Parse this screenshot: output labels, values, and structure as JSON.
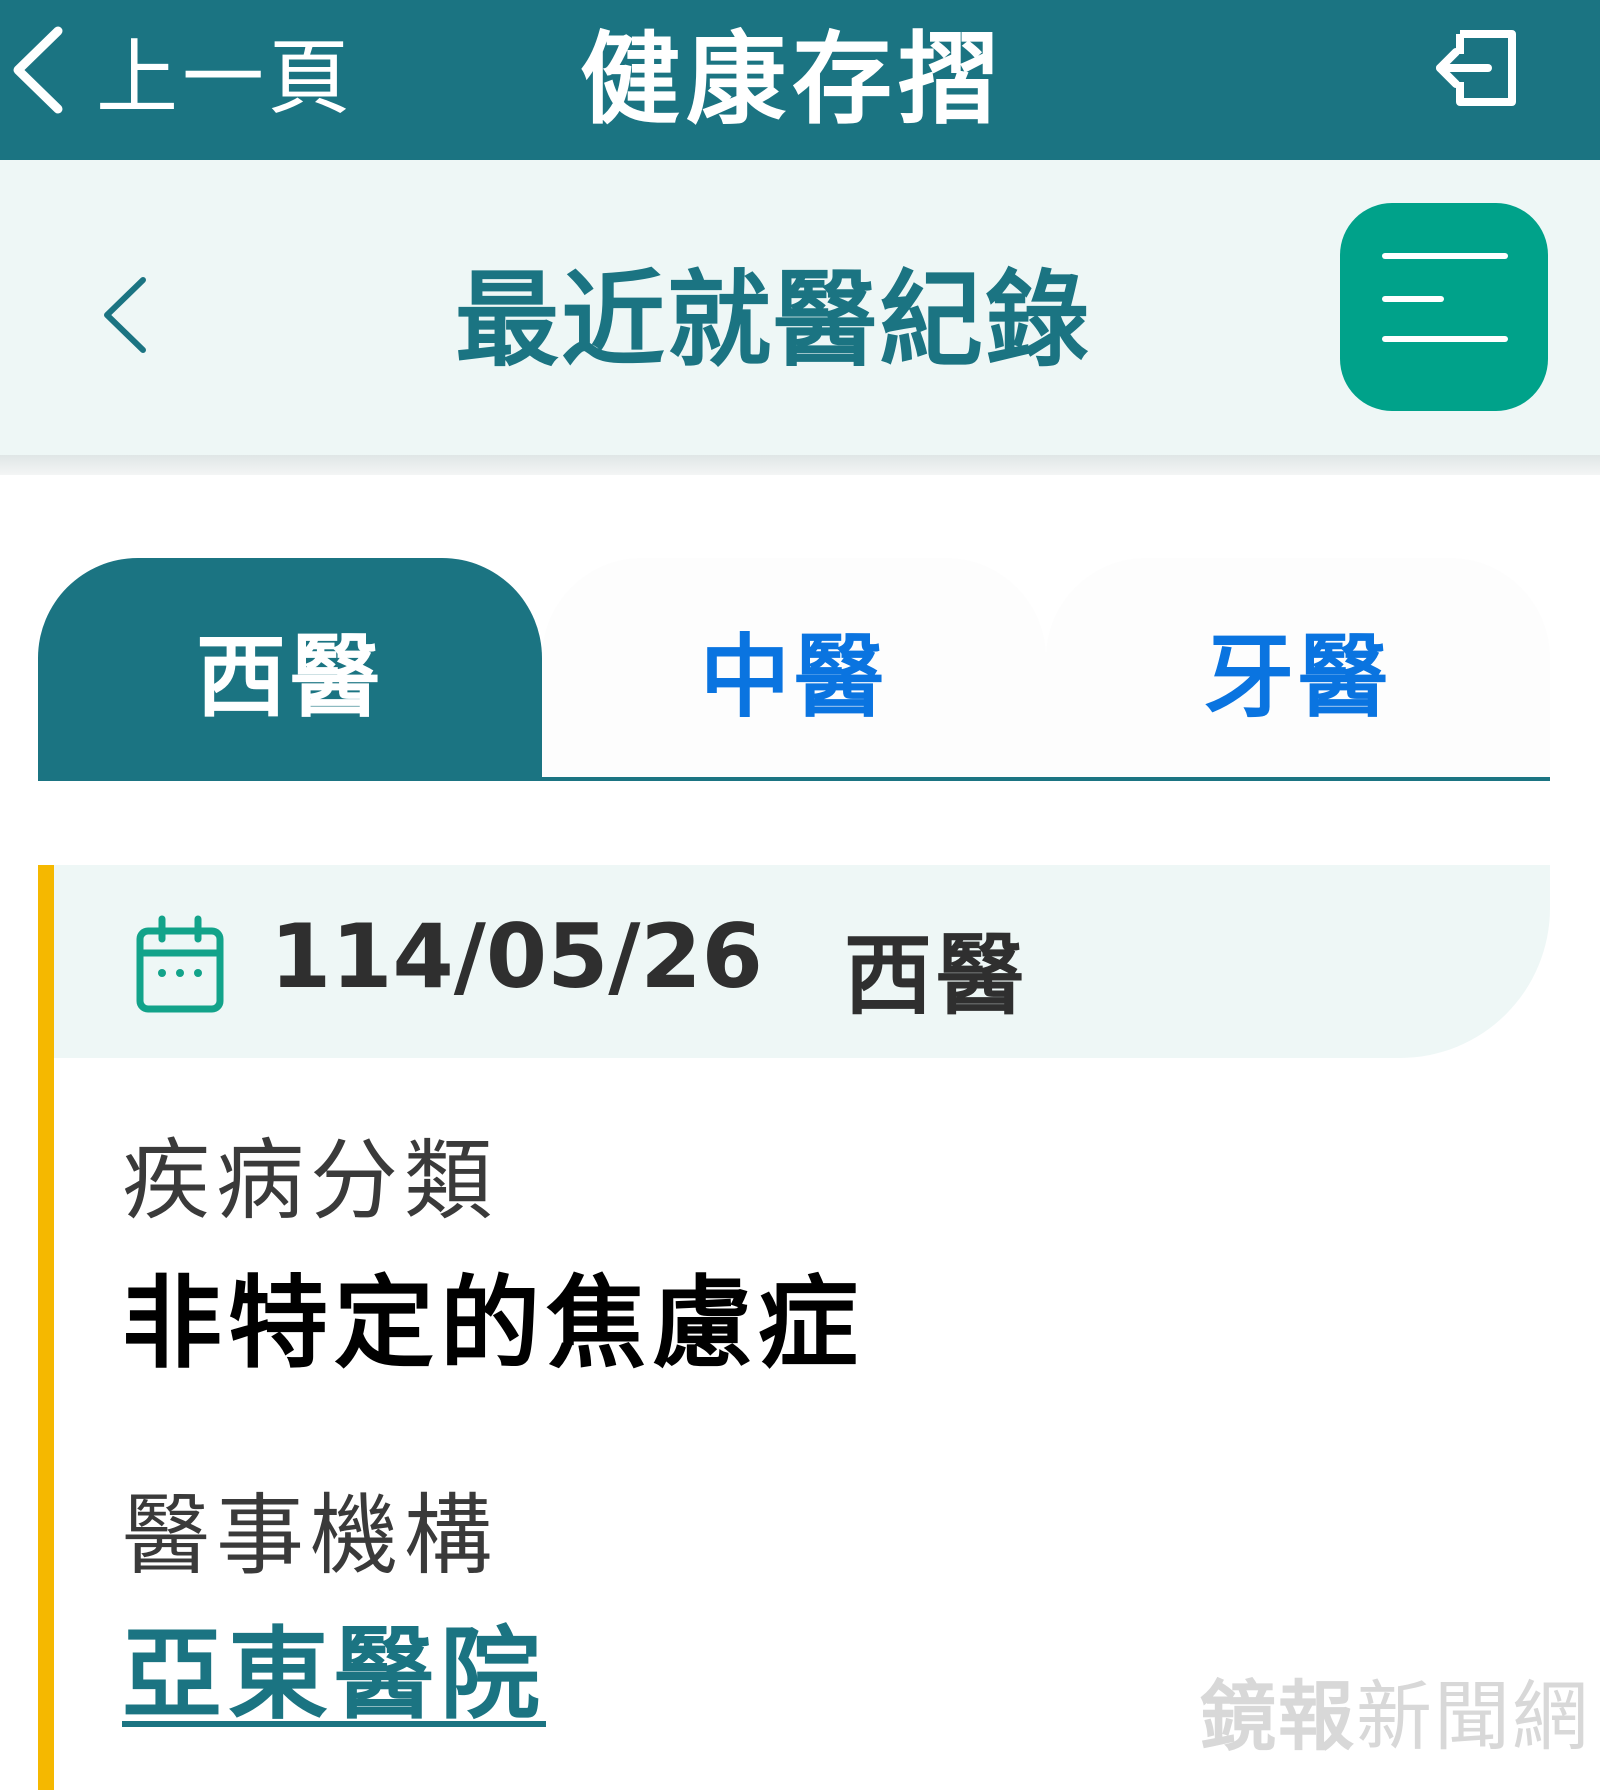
{
  "app_bar": {
    "back_label": "上一頁",
    "title": "健康存摺"
  },
  "sub_header": {
    "title": "最近就醫紀錄"
  },
  "tabs": [
    {
      "label": "西醫",
      "active": true
    },
    {
      "label": "中醫",
      "active": false
    },
    {
      "label": "牙醫",
      "active": false
    }
  ],
  "record": {
    "date": "114/05/26",
    "type": "西醫",
    "disease_label": "疾病分類",
    "disease_value": "非特定的焦慮症",
    "institution_label": "醫事機構",
    "institution_value": "亞東醫院"
  },
  "watermark": {
    "bold": "鏡報",
    "light": "新聞網"
  },
  "colors": {
    "primary": "#1b7482",
    "menu_button": "#00a28a",
    "tab_inactive_text": "#0a74e0",
    "accent_bar": "#f5b800",
    "light_bg": "#eef7f6"
  },
  "icons": {
    "back": "chevron-left-icon",
    "logout": "logout-icon",
    "menu": "menu-icon",
    "date": "calendar-icon"
  }
}
